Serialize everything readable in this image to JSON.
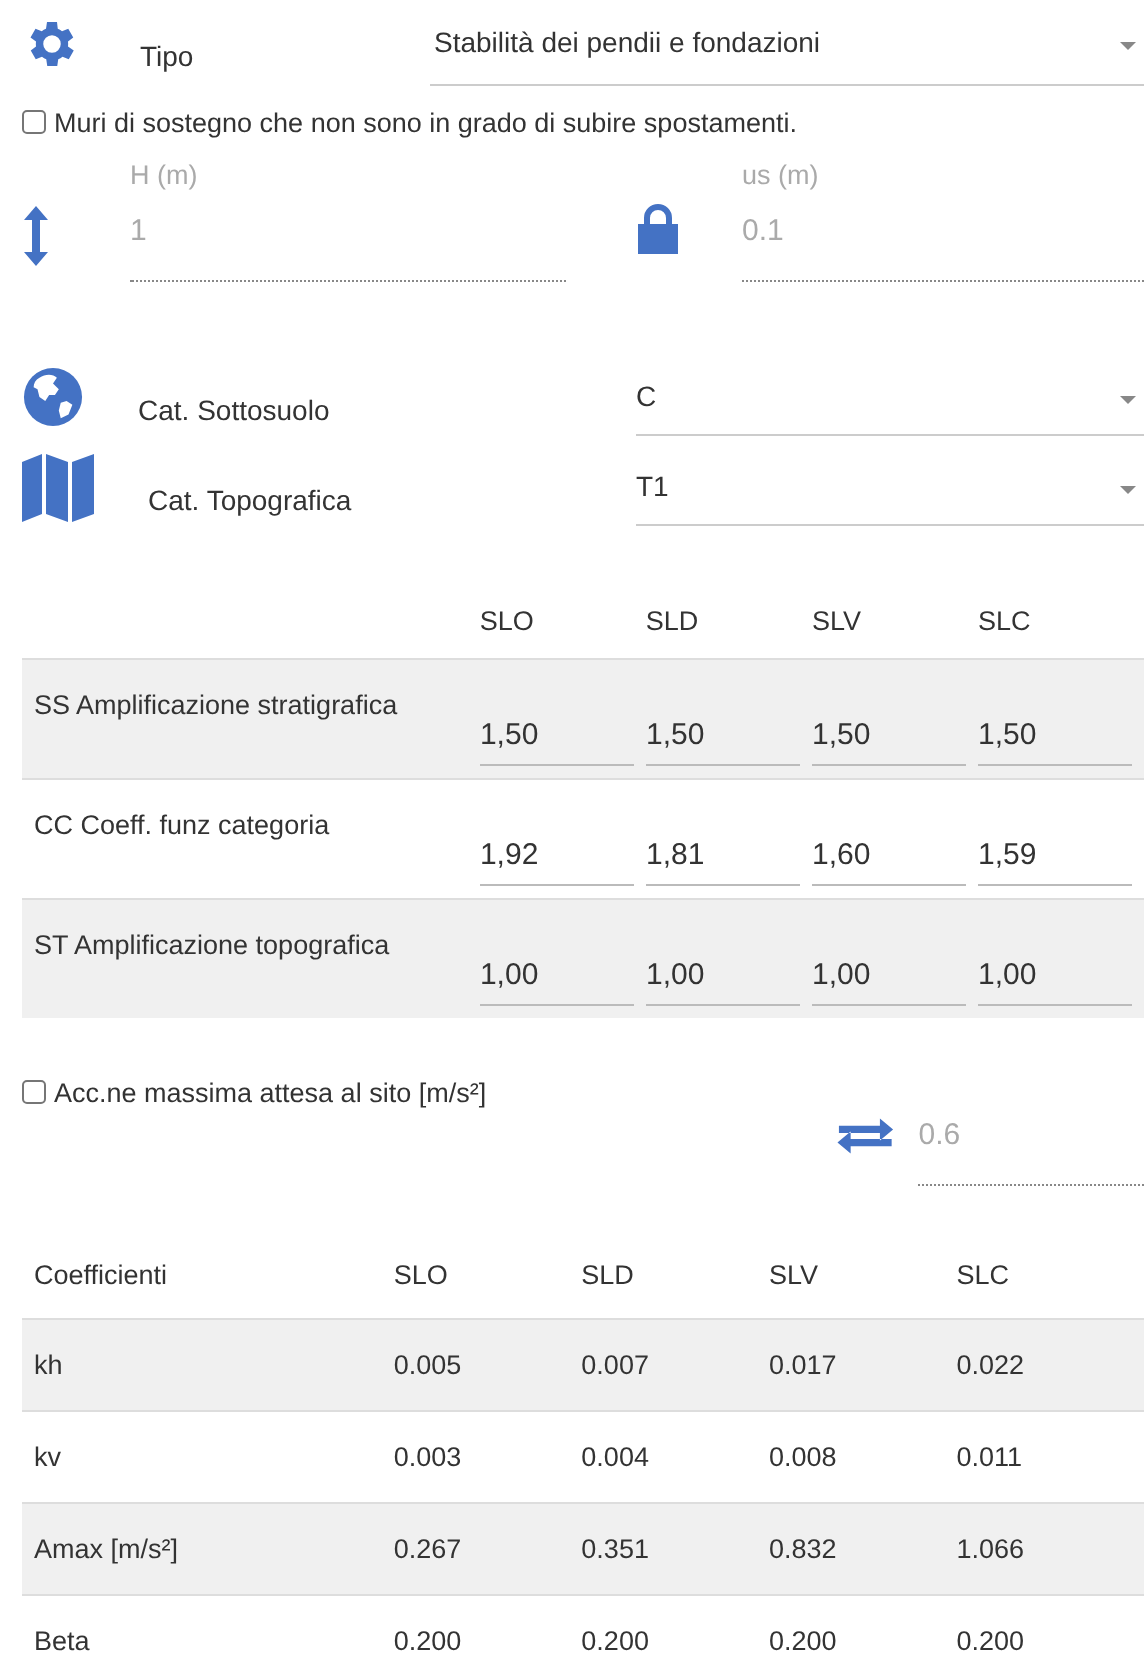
{
  "tipo": {
    "label": "Tipo",
    "value": "Stabilità dei pendii e fondazioni"
  },
  "muri_checkbox": {
    "label": "Muri di sostegno che non sono in grado di subire spostamenti.",
    "checked": false
  },
  "fields": [
    {
      "label": "H (m)",
      "value": "1",
      "disabled": true
    },
    {
      "label": "us (m)",
      "value": "0.1",
      "disabled": true
    }
  ],
  "categories": [
    {
      "label": "Cat. Sottosuolo",
      "value": "C"
    },
    {
      "label": "Cat. Topografica",
      "value": "T1"
    }
  ],
  "amplification_table": {
    "columns": [
      "SLO",
      "SLD",
      "SLV",
      "SLC"
    ],
    "rows": [
      {
        "label": "SS Amplificazione stratigrafica",
        "values": [
          "1,50",
          "1,50",
          "1,50",
          "1,50"
        ]
      },
      {
        "label": "CC Coeff. funz categoria",
        "values": [
          "1,92",
          "1,81",
          "1,60",
          "1,59"
        ]
      },
      {
        "label": "ST Amplificazione topografica",
        "values": [
          "1,00",
          "1,00",
          "1,00",
          "1,00"
        ]
      }
    ]
  },
  "acc_checkbox": {
    "label": "Acc.ne massima attesa al sito [m/s²]",
    "checked": false
  },
  "acc_field": {
    "value": "0.6",
    "disabled": true
  },
  "coefficients_table": {
    "columns": [
      "Coefficienti",
      "SLO",
      "SLD",
      "SLV",
      "SLC"
    ],
    "rows": [
      [
        "kh",
        "0.005",
        "0.007",
        "0.017",
        "0.022"
      ],
      [
        "kv",
        "0.003",
        "0.004",
        "0.008",
        "0.011"
      ],
      [
        "Amax [m/s²]",
        "0.267",
        "0.351",
        "0.832",
        "1.066"
      ],
      [
        "Beta",
        "0.200",
        "0.200",
        "0.200",
        "0.200"
      ]
    ]
  }
}
